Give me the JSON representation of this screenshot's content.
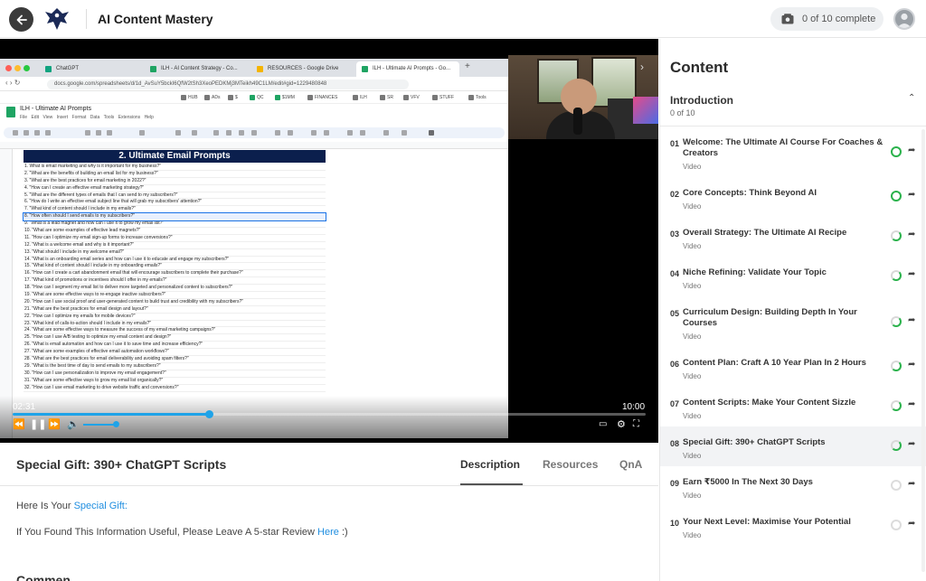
{
  "header": {
    "course_title": "AI Content Mastery",
    "progress_text": "0 of 10 complete",
    "icons": {
      "back": "arrow-left-icon",
      "logo": "eagle-logo",
      "progress": "video-icon",
      "user": "user-avatar"
    }
  },
  "video": {
    "browser": {
      "tabs": [
        "ChatGPT",
        "ILH - AI Content Strategy - Co...",
        "RESOURCES - Google Drive",
        "ILH - Ultimate AI Prompts - Go..."
      ],
      "url": "docs.google.com/spreadsheets/d/1d_AvSuY5bckI6QfW2tSh3XeoPEDKMj3MTeikh49C1LM/edit#gid=1229480848",
      "bookmarks": [
        "HUB",
        "ADs",
        "$",
        "QC",
        "$1MM",
        "FINANCES",
        "ILH",
        "SR",
        "VFV",
        "STUFF",
        "Tools"
      ],
      "sheet_title": "ILH - Ultimate AI Prompts",
      "sheet_menu": [
        "File",
        "Edit",
        "View",
        "Insert",
        "Format",
        "Data",
        "Tools",
        "Extensions",
        "Help"
      ],
      "sheet_banner": "2. Ultimate Email Prompts",
      "rows": [
        "1. What is email marketing and why is it important for my business?\"",
        "2. \"What are the benefits of building an email list for my business?\"",
        "3. \"What are the best practices for email marketing in 2022?\"",
        "4. \"How can I create an effective email marketing strategy?\"",
        "5. \"What are the different types of emails that I can send to my subscribers?\"",
        "6. \"How do I write an effective email subject line that will grab my subscribers' attention?\"",
        "7. \"What kind of content should I include in my emails?\"",
        "8. \"How often should I send emails to my subscribers?\"",
        "9. \"What is a lead magnet and how can I use it to grow my email list?\"",
        "10. \"What are some examples of effective lead magnets?\"",
        "11. \"How can I optimize my email sign-up forms to increase conversions?\"",
        "12. \"What is a welcome email and why is it important?\"",
        "13. \"What should I include in my welcome email?\"",
        "14. \"What is an onboarding email series and how can I use it to educate and engage my subscribers?\"",
        "15. \"What kind of content should I include in my onboarding emails?\"",
        "16. \"How can I create a cart abandonment email that will encourage subscribers to complete their purchase?\"",
        "17. \"What kind of promotions or incentives should I offer in my emails?\"",
        "18. \"How can I segment my email list to deliver more targeted and personalized content to subscribers?\"",
        "19. \"What are some effective ways to re-engage inactive subscribers?\"",
        "20. \"How can I use social proof and user-generated content to build trust and credibility with my subscribers?\"",
        "21. \"What are the best practices for email design and layout?\"",
        "22. \"How can I optimize my emails for mobile devices?\"",
        "23. \"What kind of calls-to-action should I include in my emails?\"",
        "24. \"What are some effective ways to measure the success of my email marketing campaigns?\"",
        "25. \"How can I use A/B testing to optimize my email content and design?\"",
        "26. \"What is email automation and how can I use it to save time and increase efficiency?\"",
        "27. \"What are some examples of effective email automation workflows?\"",
        "28. \"What are the best practices for email deliverability and avoiding spam filters?\"",
        "29. \"What is the best time of day to send emails to my subscribers?\"",
        "30. \"How can I use personalization to improve my email engagement?\"",
        "31. \"What are some effective ways to grow my email list organically?\"",
        "32. \"How can I use email marketing to drive website traffic and conversions?\""
      ],
      "selected_row": 8
    },
    "time_current": "02:31",
    "time_total": "10:00",
    "progress": 0.31,
    "volume": 0.9
  },
  "lesson": {
    "title": "Special Gift: 390+ ChatGPT Scripts",
    "tabs": [
      "Description",
      "Resources",
      "QnA"
    ],
    "active_tab": "Description",
    "desc_line1_prefix": "Here Is Your ",
    "desc_line1_link": "Special Gift:",
    "desc_line2_prefix": "If You Found This Information Useful, Please Leave A 5-star Review ",
    "desc_line2_link": "Here",
    "desc_line2_suffix": " :)",
    "comments_heading": "Comments"
  },
  "sidebar": {
    "title": "Content",
    "section": {
      "title": "Introduction",
      "count": "0 of 10"
    },
    "lessons": [
      {
        "num": "01",
        "title": "Welcome: The Ultimate AI Course For Coaches & Creators",
        "type": "Video",
        "status": "done"
      },
      {
        "num": "02",
        "title": "Core Concepts: Think Beyond AI",
        "type": "Video",
        "status": "done"
      },
      {
        "num": "03",
        "title": "Overall Strategy: The Ultimate AI Recipe",
        "type": "Video",
        "status": "partial"
      },
      {
        "num": "04",
        "title": "Niche Refining: Validate Your Topic",
        "type": "Video",
        "status": "partial"
      },
      {
        "num": "05",
        "title": "Curriculum Design: Building Depth In Your Courses",
        "type": "Video",
        "status": "partial"
      },
      {
        "num": "06",
        "title": "Content Plan: Craft A 10 Year Plan In 2 Hours",
        "type": "Video",
        "status": "partial"
      },
      {
        "num": "07",
        "title": "Content Scripts: Make Your Content Sizzle",
        "type": "Video",
        "status": "partial"
      },
      {
        "num": "08",
        "title": "Special Gift: 390+ ChatGPT Scripts",
        "type": "Video",
        "status": "partial"
      },
      {
        "num": "09",
        "title": "Earn ₹5000 In The Next 30 Days",
        "type": "Video",
        "status": "empty"
      },
      {
        "num": "10",
        "title": "Your Next Level: Maximise Your Potential",
        "type": "Video",
        "status": "empty"
      }
    ],
    "current_index": 7
  },
  "colors": {
    "accent": "#1fa3e8",
    "done": "#2bb24c",
    "banner": "#0b1f4d"
  }
}
